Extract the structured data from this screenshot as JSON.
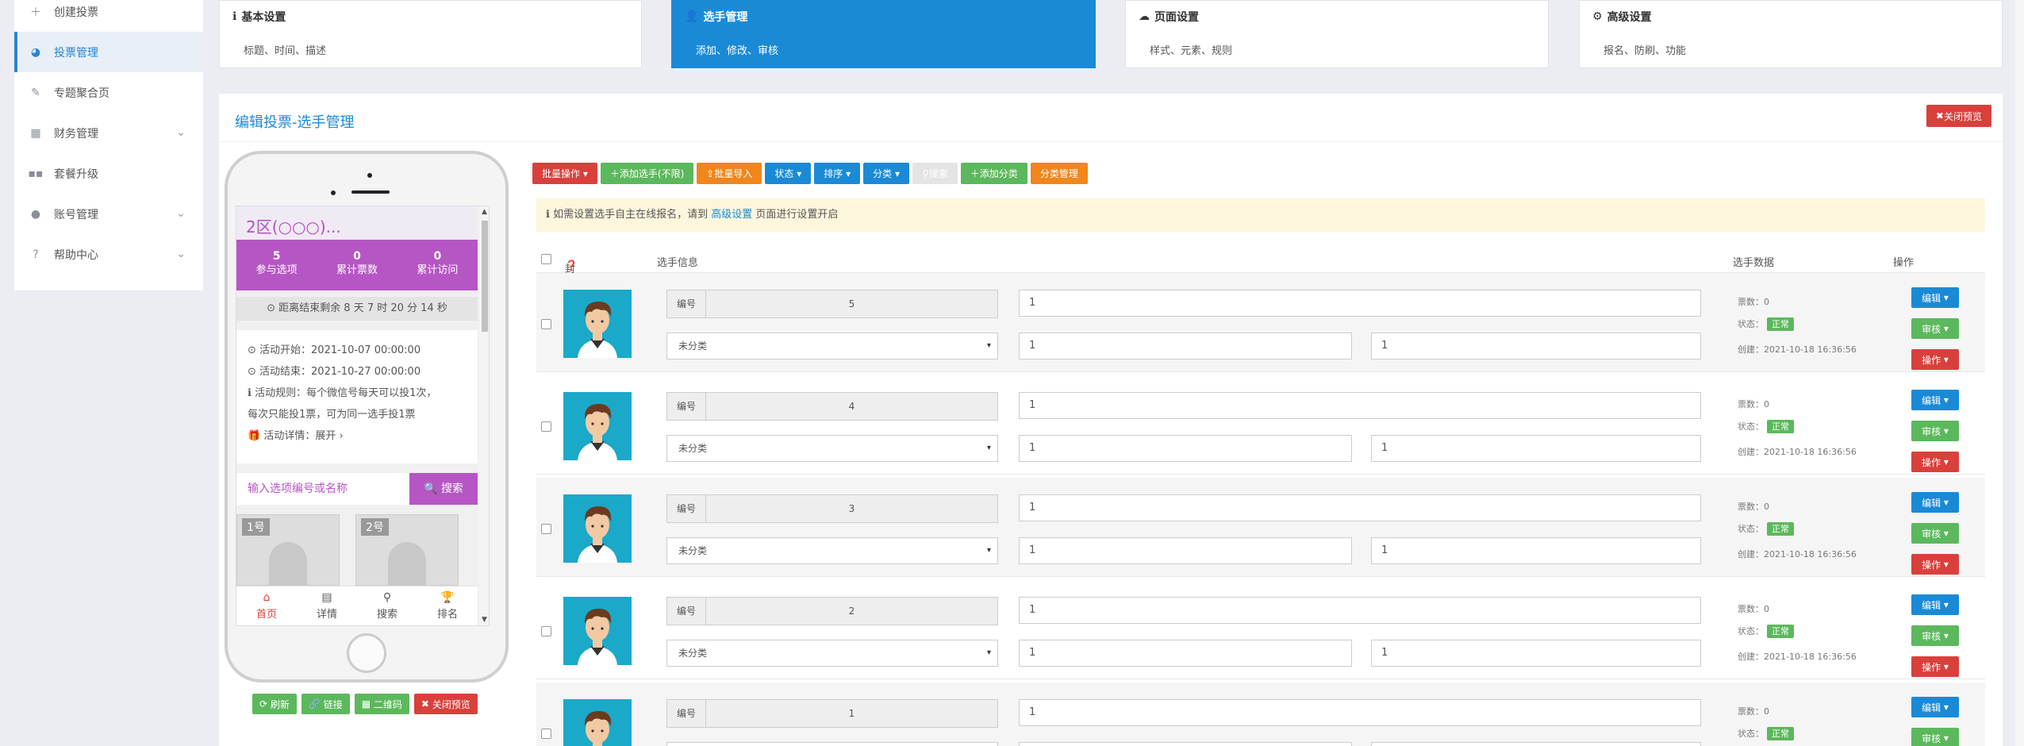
{
  "sidebar": {
    "items": [
      {
        "label": "创建投票",
        "icon": "plus-icon",
        "expandable": false
      },
      {
        "label": "投票管理",
        "icon": "pie-chart-icon",
        "expandable": false,
        "active": true
      },
      {
        "label": "专题聚合页",
        "icon": "edit-icon",
        "expandable": false
      },
      {
        "label": "财务管理",
        "icon": "table-icon",
        "expandable": true
      },
      {
        "label": "套餐升级",
        "icon": "grid-icon",
        "expandable": false
      },
      {
        "label": "账号管理",
        "icon": "user-icon",
        "expandable": true
      },
      {
        "label": "帮助中心",
        "icon": "question-icon",
        "expandable": true
      }
    ]
  },
  "steps": [
    {
      "title": "基本设置",
      "desc": "标题、时间、描述",
      "icon": "info-icon"
    },
    {
      "title": "选手管理",
      "desc": "添加、修改、审核",
      "icon": "user-plus-icon",
      "active": true
    },
    {
      "title": "页面设置",
      "desc": "样式、元素、规则",
      "icon": "cloud-icon"
    },
    {
      "title": "高级设置",
      "desc": "报名、防刷、功能",
      "icon": "gear-icon"
    }
  ],
  "panel": {
    "title": "编辑投票-选手管理",
    "close_preview": "关闭预览"
  },
  "preview": {
    "title": "2区(○○○)...",
    "stats": [
      {
        "value": "5",
        "label": "参与选项"
      },
      {
        "value": "0",
        "label": "累计票数"
      },
      {
        "value": "0",
        "label": "累计访问"
      }
    ],
    "countdown": "距离结束剩余 8 天 7 时 20 分 14 秒",
    "info": {
      "start": "活动开始：2021-10-07 00:00:00",
      "end": "活动结束：2021-10-27 00:00:00",
      "rule1": "活动规则：每个微信号每天可以投1次，",
      "rule2": "每次只能投1票，可为同一选手投1票",
      "detail": "活动详情：展开"
    },
    "search_placeholder": "输入选项编号或名称",
    "search_button": "搜索",
    "cards": [
      "1号",
      "2号"
    ],
    "tabs": [
      "首页",
      "详情",
      "搜索",
      "排名"
    ]
  },
  "phone_buttons": [
    "刷新",
    "链接",
    "二维码",
    "关闭预览"
  ],
  "toolbar": [
    "批量操作",
    "添加选手(不限)",
    "批量导入",
    "状态",
    "排序",
    "分类",
    "搜索",
    "添加分类",
    "分类管理"
  ],
  "notice": {
    "prefix": "如需设置选手自主在线报名，请到",
    "link": "高级设置",
    "suffix": "页面进行设置开启"
  },
  "table": {
    "headers": {
      "cover": "封面",
      "info": "选手信息",
      "data": "选手数据",
      "ops": "操作"
    },
    "id_label": "编号",
    "category_default": "未分类",
    "ops": [
      "编辑",
      "审核",
      "操作"
    ],
    "votes_label": "票数：",
    "status_label": "状态：",
    "status_value": "正常",
    "created_label": "创建：",
    "rows": [
      {
        "id": "5",
        "name": "1",
        "field_a": "1",
        "field_b": "1",
        "votes": "0",
        "created": "2021-10-18 16:36:56"
      },
      {
        "id": "4",
        "name": "1",
        "field_a": "1",
        "field_b": "1",
        "votes": "0",
        "created": "2021-10-18 16:36:56"
      },
      {
        "id": "3",
        "name": "1",
        "field_a": "1",
        "field_b": "1",
        "votes": "0",
        "created": "2021-10-18 16:36:56"
      },
      {
        "id": "2",
        "name": "1",
        "field_a": "1",
        "field_b": "1",
        "votes": "0",
        "created": "2021-10-18 16:36:56"
      },
      {
        "id": "1",
        "name": "1",
        "field_a": "",
        "field_b": "",
        "votes": "0",
        "created": ""
      }
    ]
  }
}
